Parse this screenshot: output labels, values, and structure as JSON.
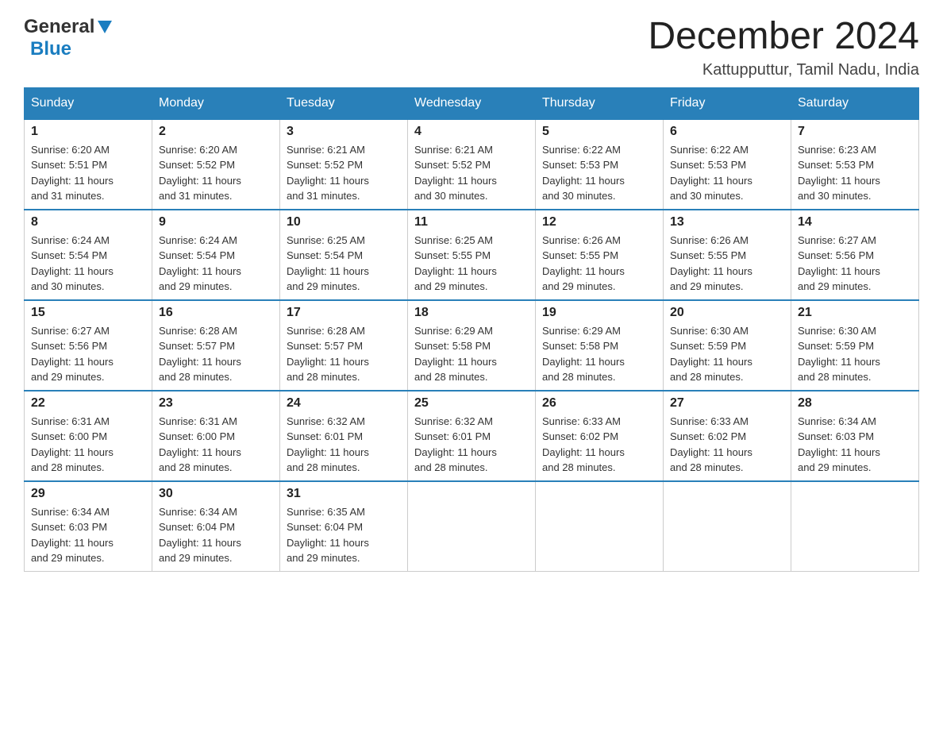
{
  "header": {
    "logo": {
      "general": "General",
      "blue": "Blue"
    },
    "title": "December 2024",
    "location": "Kattupputtur, Tamil Nadu, India"
  },
  "calendar": {
    "days_of_week": [
      "Sunday",
      "Monday",
      "Tuesday",
      "Wednesday",
      "Thursday",
      "Friday",
      "Saturday"
    ],
    "weeks": [
      [
        {
          "day": "1",
          "sunrise": "Sunrise: 6:20 AM",
          "sunset": "Sunset: 5:51 PM",
          "daylight": "Daylight: 11 hours and 31 minutes."
        },
        {
          "day": "2",
          "sunrise": "Sunrise: 6:20 AM",
          "sunset": "Sunset: 5:52 PM",
          "daylight": "Daylight: 11 hours and 31 minutes."
        },
        {
          "day": "3",
          "sunrise": "Sunrise: 6:21 AM",
          "sunset": "Sunset: 5:52 PM",
          "daylight": "Daylight: 11 hours and 31 minutes."
        },
        {
          "day": "4",
          "sunrise": "Sunrise: 6:21 AM",
          "sunset": "Sunset: 5:52 PM",
          "daylight": "Daylight: 11 hours and 30 minutes."
        },
        {
          "day": "5",
          "sunrise": "Sunrise: 6:22 AM",
          "sunset": "Sunset: 5:53 PM",
          "daylight": "Daylight: 11 hours and 30 minutes."
        },
        {
          "day": "6",
          "sunrise": "Sunrise: 6:22 AM",
          "sunset": "Sunset: 5:53 PM",
          "daylight": "Daylight: 11 hours and 30 minutes."
        },
        {
          "day": "7",
          "sunrise": "Sunrise: 6:23 AM",
          "sunset": "Sunset: 5:53 PM",
          "daylight": "Daylight: 11 hours and 30 minutes."
        }
      ],
      [
        {
          "day": "8",
          "sunrise": "Sunrise: 6:24 AM",
          "sunset": "Sunset: 5:54 PM",
          "daylight": "Daylight: 11 hours and 30 minutes."
        },
        {
          "day": "9",
          "sunrise": "Sunrise: 6:24 AM",
          "sunset": "Sunset: 5:54 PM",
          "daylight": "Daylight: 11 hours and 29 minutes."
        },
        {
          "day": "10",
          "sunrise": "Sunrise: 6:25 AM",
          "sunset": "Sunset: 5:54 PM",
          "daylight": "Daylight: 11 hours and 29 minutes."
        },
        {
          "day": "11",
          "sunrise": "Sunrise: 6:25 AM",
          "sunset": "Sunset: 5:55 PM",
          "daylight": "Daylight: 11 hours and 29 minutes."
        },
        {
          "day": "12",
          "sunrise": "Sunrise: 6:26 AM",
          "sunset": "Sunset: 5:55 PM",
          "daylight": "Daylight: 11 hours and 29 minutes."
        },
        {
          "day": "13",
          "sunrise": "Sunrise: 6:26 AM",
          "sunset": "Sunset: 5:55 PM",
          "daylight": "Daylight: 11 hours and 29 minutes."
        },
        {
          "day": "14",
          "sunrise": "Sunrise: 6:27 AM",
          "sunset": "Sunset: 5:56 PM",
          "daylight": "Daylight: 11 hours and 29 minutes."
        }
      ],
      [
        {
          "day": "15",
          "sunrise": "Sunrise: 6:27 AM",
          "sunset": "Sunset: 5:56 PM",
          "daylight": "Daylight: 11 hours and 29 minutes."
        },
        {
          "day": "16",
          "sunrise": "Sunrise: 6:28 AM",
          "sunset": "Sunset: 5:57 PM",
          "daylight": "Daylight: 11 hours and 28 minutes."
        },
        {
          "day": "17",
          "sunrise": "Sunrise: 6:28 AM",
          "sunset": "Sunset: 5:57 PM",
          "daylight": "Daylight: 11 hours and 28 minutes."
        },
        {
          "day": "18",
          "sunrise": "Sunrise: 6:29 AM",
          "sunset": "Sunset: 5:58 PM",
          "daylight": "Daylight: 11 hours and 28 minutes."
        },
        {
          "day": "19",
          "sunrise": "Sunrise: 6:29 AM",
          "sunset": "Sunset: 5:58 PM",
          "daylight": "Daylight: 11 hours and 28 minutes."
        },
        {
          "day": "20",
          "sunrise": "Sunrise: 6:30 AM",
          "sunset": "Sunset: 5:59 PM",
          "daylight": "Daylight: 11 hours and 28 minutes."
        },
        {
          "day": "21",
          "sunrise": "Sunrise: 6:30 AM",
          "sunset": "Sunset: 5:59 PM",
          "daylight": "Daylight: 11 hours and 28 minutes."
        }
      ],
      [
        {
          "day": "22",
          "sunrise": "Sunrise: 6:31 AM",
          "sunset": "Sunset: 6:00 PM",
          "daylight": "Daylight: 11 hours and 28 minutes."
        },
        {
          "day": "23",
          "sunrise": "Sunrise: 6:31 AM",
          "sunset": "Sunset: 6:00 PM",
          "daylight": "Daylight: 11 hours and 28 minutes."
        },
        {
          "day": "24",
          "sunrise": "Sunrise: 6:32 AM",
          "sunset": "Sunset: 6:01 PM",
          "daylight": "Daylight: 11 hours and 28 minutes."
        },
        {
          "day": "25",
          "sunrise": "Sunrise: 6:32 AM",
          "sunset": "Sunset: 6:01 PM",
          "daylight": "Daylight: 11 hours and 28 minutes."
        },
        {
          "day": "26",
          "sunrise": "Sunrise: 6:33 AM",
          "sunset": "Sunset: 6:02 PM",
          "daylight": "Daylight: 11 hours and 28 minutes."
        },
        {
          "day": "27",
          "sunrise": "Sunrise: 6:33 AM",
          "sunset": "Sunset: 6:02 PM",
          "daylight": "Daylight: 11 hours and 28 minutes."
        },
        {
          "day": "28",
          "sunrise": "Sunrise: 6:34 AM",
          "sunset": "Sunset: 6:03 PM",
          "daylight": "Daylight: 11 hours and 29 minutes."
        }
      ],
      [
        {
          "day": "29",
          "sunrise": "Sunrise: 6:34 AM",
          "sunset": "Sunset: 6:03 PM",
          "daylight": "Daylight: 11 hours and 29 minutes."
        },
        {
          "day": "30",
          "sunrise": "Sunrise: 6:34 AM",
          "sunset": "Sunset: 6:04 PM",
          "daylight": "Daylight: 11 hours and 29 minutes."
        },
        {
          "day": "31",
          "sunrise": "Sunrise: 6:35 AM",
          "sunset": "Sunset: 6:04 PM",
          "daylight": "Daylight: 11 hours and 29 minutes."
        },
        null,
        null,
        null,
        null
      ]
    ]
  }
}
